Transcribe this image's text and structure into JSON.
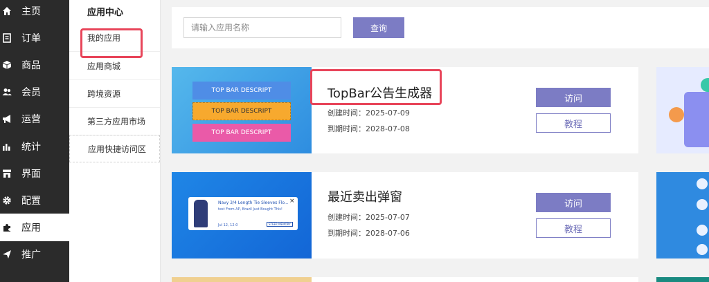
{
  "sidebar": {
    "items": [
      {
        "label": "主页",
        "icon": "home-icon"
      },
      {
        "label": "订单",
        "icon": "order-icon"
      },
      {
        "label": "商品",
        "icon": "box-icon"
      },
      {
        "label": "会员",
        "icon": "users-icon"
      },
      {
        "label": "运营",
        "icon": "megaphone-icon"
      },
      {
        "label": "统计",
        "icon": "bar-chart-icon"
      },
      {
        "label": "界面",
        "icon": "store-icon"
      },
      {
        "label": "配置",
        "icon": "gear-icon"
      },
      {
        "label": "应用",
        "icon": "puzzle-icon",
        "active": true
      },
      {
        "label": "推广",
        "icon": "send-icon"
      }
    ]
  },
  "subnav": {
    "title": "应用中心",
    "items": [
      {
        "label": "我的应用",
        "highlighted": true
      },
      {
        "label": "应用商城"
      },
      {
        "label": "跨境资源"
      },
      {
        "label": "第三方应用市场"
      },
      {
        "label": "应用快捷访问区"
      }
    ]
  },
  "search": {
    "placeholder": "请输入应用名称",
    "value": "",
    "button": "查询"
  },
  "apps": [
    {
      "name": "TopBar公告生成器",
      "created": "创建时间：2025-07-09",
      "expires": "到期时间：2028-07-08",
      "visit": "访问",
      "guide": "教程",
      "thumb_bars": [
        "TOP BAR DESCRIPT",
        "TOP BAR DESCRIPT",
        "TOP BAR DESCRIPT"
      ]
    },
    {
      "name": "最近卖出弹窗",
      "created": "创建时间：2025-07-07",
      "expires": "到期时间：2028-07-06",
      "visit": "访问",
      "guide": "教程",
      "popup": {
        "title": "Navy 3/4 Length Tie Sleeves Flo...",
        "text": "test From AP, Brazil Just Bought This!",
        "date": "Jul 12, 12:0",
        "badge": "STEER MEMORY"
      }
    }
  ],
  "colors": {
    "sidebar": "#2b2b2b",
    "accent": "#7c7cc4",
    "highlight": "#e8455a"
  }
}
